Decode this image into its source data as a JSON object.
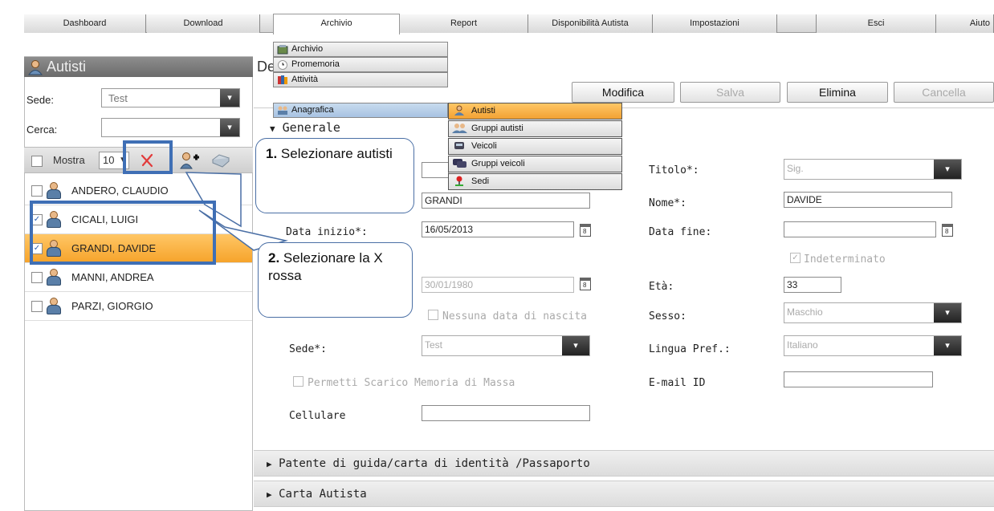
{
  "nav": {
    "tabs": [
      "Dashboard",
      "Download",
      "Archivio",
      "Report",
      "Disponibilità Autista",
      "Impostazioni",
      "Esci",
      "Aiuto"
    ]
  },
  "menu": {
    "items": [
      "Archivio",
      "Promemoria",
      "Attività",
      "Anagrafica"
    ],
    "submenu": [
      "Autisti",
      "Gruppi autisti",
      "Veicoli",
      "Gruppi veicoli",
      "Sedi"
    ]
  },
  "left": {
    "title": "Autisti",
    "sede_label": "Sede:",
    "sede_value": "Test",
    "cerca_label": "Cerca:",
    "cerca_value": "",
    "mostra_label": "Mostra",
    "mostra_value": "10",
    "drivers": [
      {
        "name": "ANDERO, CLAUDIO",
        "checked": false,
        "selected": false
      },
      {
        "name": "CICALI, LUIGI",
        "checked": true,
        "selected": false
      },
      {
        "name": "GRANDI, DAVIDE",
        "checked": true,
        "selected": true
      },
      {
        "name": "MANNI, ANDREA",
        "checked": false,
        "selected": false
      },
      {
        "name": "PARZI, GIORGIO",
        "checked": false,
        "selected": false
      }
    ]
  },
  "right": {
    "title_fragment": "De",
    "buttons": {
      "modifica": "Modifica",
      "salva": "Salva",
      "elimina": "Elimina",
      "cancella": "Cancella"
    },
    "section_generale": "Generale",
    "form": {
      "titolo_label": "Titolo*:",
      "titolo_value": "Sig.",
      "cognome_value": "GRANDI",
      "nome_label": "Nome*:",
      "nome_value": "DAVIDE",
      "data_inizio_label": "Data inizio*:",
      "data_inizio_value": "16/05/2013",
      "data_fine_label": "Data fine:",
      "data_fine_value": "",
      "indeterminato_label": "Indeterminato",
      "data_nascita_value": "30/01/1980",
      "eta_label": "Età:",
      "eta_value": "33",
      "nessuna_data_label": "Nessuna data di nascita",
      "sesso_label": "Sesso:",
      "sesso_value": "Maschio",
      "sede_label": "Sede*:",
      "sede_value": "Test",
      "lingua_label": "Lingua Pref.:",
      "lingua_value": "Italiano",
      "permetti_label": "Permetti Scarico Memoria di Massa",
      "email_label": "E-mail ID",
      "email_value": "",
      "cellulare_label": "Cellulare",
      "cellulare_value": ""
    },
    "section_patente": "Patente di guida/carta di identità /Passaporto",
    "section_carta": "Carta Autista"
  },
  "callouts": {
    "c1_num": "1.",
    "c1_text": " Selezionare autisti",
    "c2_num": "2.",
    "c2_text": " Selezionare la X rossa"
  },
  "colors": {
    "accent_blue": "#3f6fb5",
    "selected_row": "#f6a42b",
    "delete_x": "#e23b3b"
  }
}
